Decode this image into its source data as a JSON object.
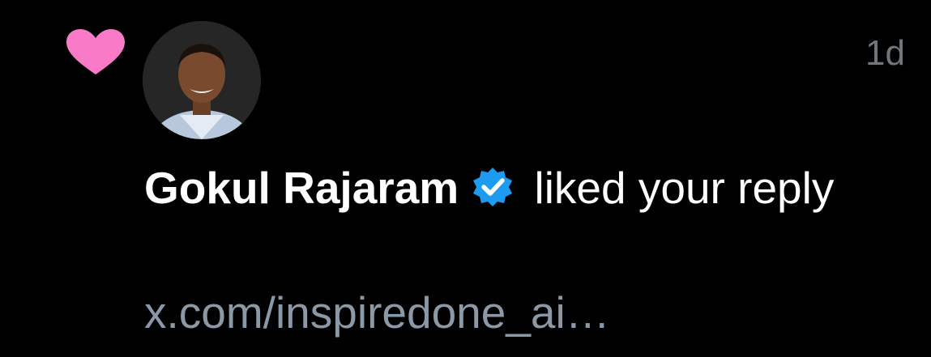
{
  "notification": {
    "type_icon": "heart-icon",
    "type_color": "#f97bc8",
    "avatar_icon": "avatar",
    "user_name": "Gokul Rajaram",
    "verified_icon": "verified-badge-icon",
    "verified_color": "#1d9bf0",
    "action_text": " liked your reply",
    "timestamp": "1d",
    "reply_preview": "x.com/inspiredone_ai…"
  }
}
